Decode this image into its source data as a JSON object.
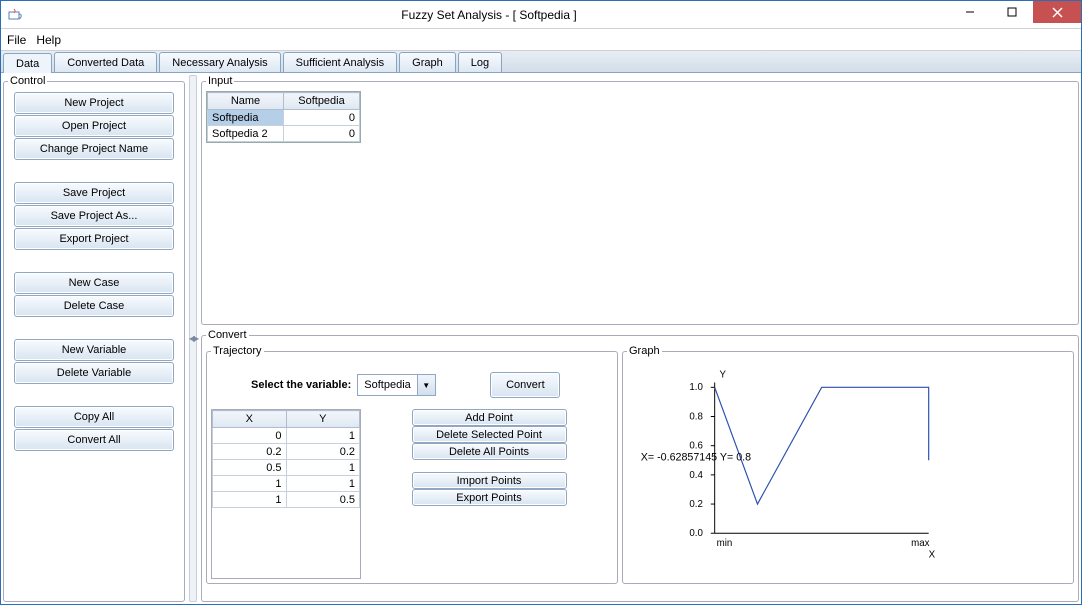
{
  "window": {
    "title": "Fuzzy Set Analysis - [ Softpedia ]"
  },
  "menu": {
    "file": "File",
    "help": "Help"
  },
  "tabs": [
    "Data",
    "Converted Data",
    "Necessary Analysis",
    "Sufficient Analysis",
    "Graph",
    "Log"
  ],
  "control": {
    "legend": "Control",
    "buttons": {
      "new_project": "New Project",
      "open_project": "Open Project",
      "change_name": "Change Project Name",
      "save_project": "Save Project",
      "save_as": "Save Project As...",
      "export_project": "Export Project",
      "new_case": "New Case",
      "delete_case": "Delete Case",
      "new_variable": "New Variable",
      "delete_variable": "Delete Variable",
      "copy_all": "Copy All",
      "convert_all": "Convert All"
    }
  },
  "input": {
    "legend": "Input",
    "headers": [
      "Name",
      "Softpedia"
    ],
    "rows": [
      {
        "name": "Softpedia",
        "val": "0",
        "selected": true
      },
      {
        "name": "Softpedia 2",
        "val": "0",
        "selected": false
      }
    ]
  },
  "convert": {
    "legend": "Convert",
    "trajectory": {
      "legend": "Trajectory",
      "select_label": "Select the variable:",
      "selected": "Softpedia",
      "convert_btn": "Convert",
      "headers": [
        "X",
        "Y"
      ],
      "rows": [
        {
          "x": "0",
          "y": "1"
        },
        {
          "x": "0.2",
          "y": "0.2"
        },
        {
          "x": "0.5",
          "y": "1"
        },
        {
          "x": "1",
          "y": "1"
        },
        {
          "x": "1",
          "y": "0.5"
        }
      ],
      "btns": {
        "add": "Add Point",
        "del_sel": "Delete Selected Point",
        "del_all": "Delete All Points",
        "import": "Import Points",
        "export": "Export Points"
      }
    },
    "graph": {
      "legend": "Graph",
      "ylabel": "Y",
      "xlabel": "X",
      "xmin": "min",
      "xmax": "max",
      "cursor": "X= -0.62857145 Y= 0.8",
      "yticks": [
        "0.0",
        "0.2",
        "0.4",
        "0.6",
        "0.8",
        "1.0"
      ]
    }
  },
  "chart_data": {
    "type": "line",
    "title": "",
    "xlabel": "X",
    "ylabel": "Y",
    "xlim": [
      0,
      1
    ],
    "ylim": [
      0,
      1
    ],
    "xticklabels": [
      "min",
      "max"
    ],
    "series": [
      {
        "name": "Softpedia",
        "x": [
          0,
          0.2,
          0.5,
          1,
          1
        ],
        "y": [
          1,
          0.2,
          1,
          1,
          0.5
        ]
      }
    ],
    "cursor": {
      "x": -0.62857145,
      "y": 0.8
    }
  }
}
